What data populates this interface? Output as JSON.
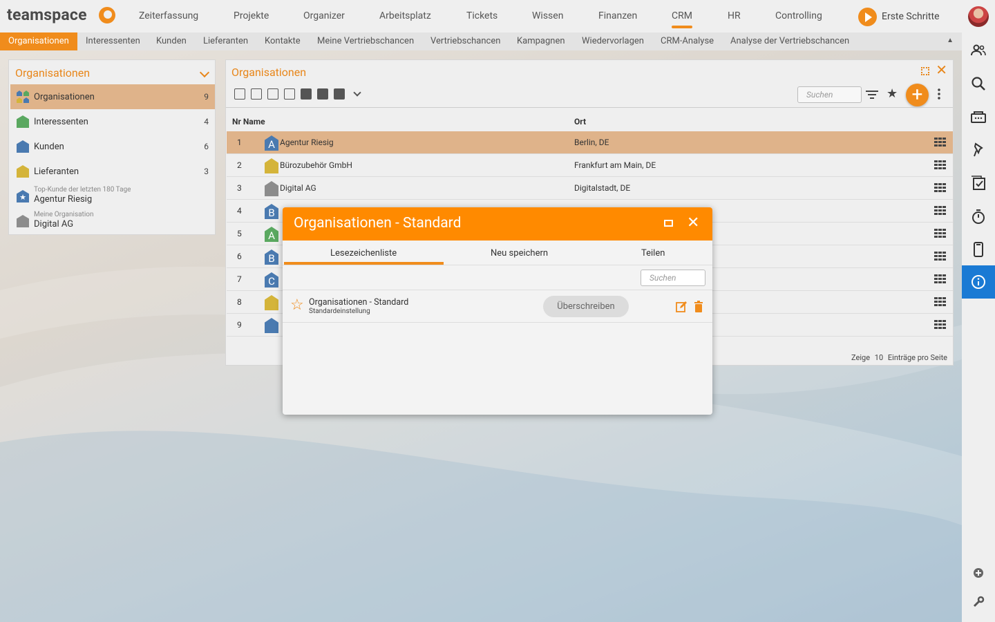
{
  "app": {
    "logo_text": "teamspace"
  },
  "topnav": {
    "items": [
      "Zeiterfassung",
      "Projekte",
      "Organizer",
      "Arbeitsplatz",
      "Tickets",
      "Wissen",
      "Finanzen",
      "CRM",
      "HR",
      "Controlling"
    ],
    "active": "CRM",
    "erste_schritte": "Erste Schritte"
  },
  "subnav": {
    "items": [
      "Organisationen",
      "Interessenten",
      "Kunden",
      "Lieferanten",
      "Kontakte",
      "Meine Vertriebschancen",
      "Vertriebschancen",
      "Kampagnen",
      "Wiedervorlagen",
      "CRM-Analyse",
      "Analyse der Vertriebschancen"
    ],
    "active": "Organisationen"
  },
  "leftpanel": {
    "title": "Organisationen",
    "items": [
      {
        "label": "Organisationen",
        "count": "9"
      },
      {
        "label": "Interessenten",
        "count": "4"
      },
      {
        "label": "Kunden",
        "count": "6"
      },
      {
        "label": "Lieferanten",
        "count": "3"
      }
    ],
    "top_kunde": {
      "caption": "Top-Kunde der letzten 180 Tage",
      "name": "Agentur Riesig"
    },
    "meine_org": {
      "caption": "Meine Organisation",
      "name": "Digital AG"
    }
  },
  "mainpanel": {
    "title": "Organisationen",
    "search_placeholder": "Suchen",
    "columns": {
      "nr_name": "Nr Name",
      "ort": "Ort"
    },
    "rows": [
      {
        "nr": "1",
        "letter": "A",
        "name": "Agentur Riesig",
        "ort": "Berlin, DE",
        "color": "#4a7ab0"
      },
      {
        "nr": "2",
        "letter": "",
        "name": "Bürozubehör GmbH",
        "ort": "Frankfurt am Main, DE",
        "color": "#d4b43a"
      },
      {
        "nr": "3",
        "letter": "",
        "name": "Digital AG",
        "ort": "Digitalstadt, DE",
        "color": "#8c8c8c"
      },
      {
        "nr": "4",
        "letter": "B",
        "name": "",
        "ort": "",
        "color": "#4a7ab0"
      },
      {
        "nr": "5",
        "letter": "A",
        "name": "",
        "ort": "",
        "color": "#5aa860"
      },
      {
        "nr": "6",
        "letter": "B",
        "name": "",
        "ort": "",
        "color": "#4a7ab0"
      },
      {
        "nr": "7",
        "letter": "C",
        "name": "",
        "ort": "",
        "color": "#4a7ab0"
      },
      {
        "nr": "8",
        "letter": "",
        "name": "",
        "ort": "",
        "color": "#d4b43a"
      },
      {
        "nr": "9",
        "letter": "",
        "name": "",
        "ort": "",
        "color": "#4a7ab0"
      }
    ],
    "footer": {
      "prefix": "Zeige",
      "count": "10",
      "suffix": "Einträge pro Seite"
    }
  },
  "modal": {
    "title": "Organisationen - Standard",
    "tabs": [
      "Lesezeichenliste",
      "Neu speichern",
      "Teilen"
    ],
    "search_placeholder": "Suchen",
    "bookmark": {
      "name": "Organisationen - Standard",
      "sub": "Standardeinstellung",
      "button": "Überschreiben"
    }
  },
  "colors": {
    "accent": "#f08c1c",
    "info": "#1a7ad4"
  }
}
